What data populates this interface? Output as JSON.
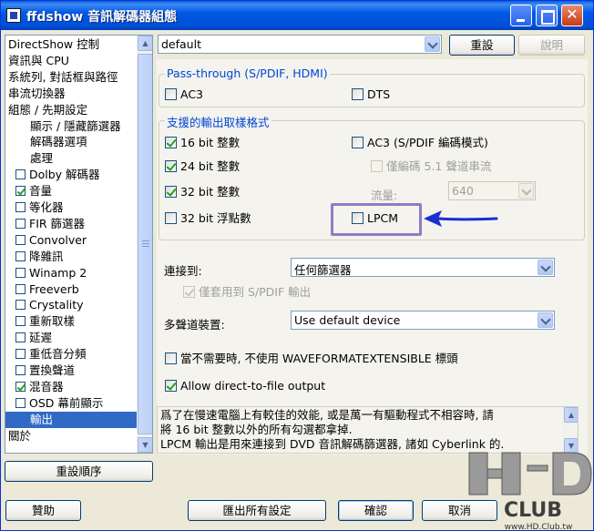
{
  "window": {
    "title": "ffdshow 音訊解碼器組態"
  },
  "tree": {
    "items": [
      {
        "label": "DirectShow 控制",
        "indent": 0,
        "checkbox": null
      },
      {
        "label": "資訊與 CPU",
        "indent": 0,
        "checkbox": null
      },
      {
        "label": "系統列, 對話框與路徑",
        "indent": 0,
        "checkbox": null
      },
      {
        "label": "串流切換器",
        "indent": 0,
        "checkbox": null
      },
      {
        "label": "組態 / 先期設定",
        "indent": 0,
        "checkbox": null
      },
      {
        "label": "顯示 / 隱藏篩選器",
        "indent": 2,
        "checkbox": null
      },
      {
        "label": "解碼器選項",
        "indent": 2,
        "checkbox": null
      },
      {
        "label": "處理",
        "indent": 2,
        "checkbox": null
      },
      {
        "label": "Dolby 解碼器",
        "indent": 1,
        "checkbox": false
      },
      {
        "label": "音量",
        "indent": 1,
        "checkbox": true
      },
      {
        "label": "等化器",
        "indent": 1,
        "checkbox": false
      },
      {
        "label": "FIR 篩選器",
        "indent": 1,
        "checkbox": false
      },
      {
        "label": "Convolver",
        "indent": 1,
        "checkbox": false
      },
      {
        "label": "降雜訊",
        "indent": 1,
        "checkbox": false
      },
      {
        "label": "Winamp 2",
        "indent": 1,
        "checkbox": false
      },
      {
        "label": "Freeverb",
        "indent": 1,
        "checkbox": false
      },
      {
        "label": "Crystality",
        "indent": 1,
        "checkbox": false
      },
      {
        "label": "重新取樣",
        "indent": 1,
        "checkbox": false
      },
      {
        "label": "延遲",
        "indent": 1,
        "checkbox": false
      },
      {
        "label": "重低音分頻",
        "indent": 1,
        "checkbox": false
      },
      {
        "label": "置換聲道",
        "indent": 1,
        "checkbox": false
      },
      {
        "label": "混音器",
        "indent": 1,
        "checkbox": true
      },
      {
        "label": "OSD 幕前顯示",
        "indent": 1,
        "checkbox": false
      },
      {
        "label": "輸出",
        "indent": 2,
        "checkbox": null,
        "selected": true
      },
      {
        "label": "關於",
        "indent": 0,
        "checkbox": null
      }
    ],
    "reset_order_label": "重設順序"
  },
  "preset": {
    "value": "default",
    "reset_label": "重設",
    "description_label": "說明"
  },
  "passthrough": {
    "title": "Pass-through (S/PDIF, HDMI)",
    "ac3": {
      "label": "AC3",
      "checked": false
    },
    "dts": {
      "label": "DTS",
      "checked": false
    }
  },
  "formats": {
    "title": "支援的輸出取樣格式",
    "bit16": {
      "label": "16 bit 整數",
      "checked": true
    },
    "bit24": {
      "label": "24 bit 整數",
      "checked": true
    },
    "bit32": {
      "label": "32 bit 整數",
      "checked": true
    },
    "float32": {
      "label": "32 bit 浮點數",
      "checked": false
    },
    "ac3_spdif": {
      "label": "AC3 (S/PDIF 編碼模式)",
      "checked": false
    },
    "only51": {
      "label": "僅編碼 5.1 聲道串流",
      "checked": false
    },
    "bitrate_label": "流量:",
    "bitrate_value": "640",
    "lpcm": {
      "label": "LPCM",
      "checked": false
    }
  },
  "output": {
    "connect_label": "連接到:",
    "connect_value": "任何篩選器",
    "spdif_only": {
      "label": "僅套用到 S/PDIF 輸出",
      "checked": true
    },
    "multichannel_label": "多聲道裝置:",
    "multichannel_value": "Use default device",
    "no_wfx": {
      "label": "當不需要時, 不使用 WAVEFORMATEXTENSIBLE 標頭",
      "checked": false
    },
    "direct_file": {
      "label": "Allow direct-to-file output",
      "checked": true
    }
  },
  "description": {
    "line1": "爲了在慢速電腦上有較佳的效能, 或是萬一有驅動程式不相容時, 請",
    "line2": "將 16 bit 整數以外的所有勾選都拿掉.",
    "line3": "LPCM 輸出是用來連接到 DVD 音訊解碼篩選器, 諸如 Cyberlink 的."
  },
  "footer": {
    "help_label": "贊助",
    "export_label": "匯出所有設定",
    "ok_label": "確認",
    "cancel_label": "取消"
  },
  "watermark": {
    "line1": "CLUB",
    "line2": "www.HD.Club.tw"
  },
  "colors": {
    "accent": "#0046D5",
    "highlight_box": "#8E7CC3",
    "arrow": "#1A2FD0",
    "selection": "#316AC5"
  }
}
